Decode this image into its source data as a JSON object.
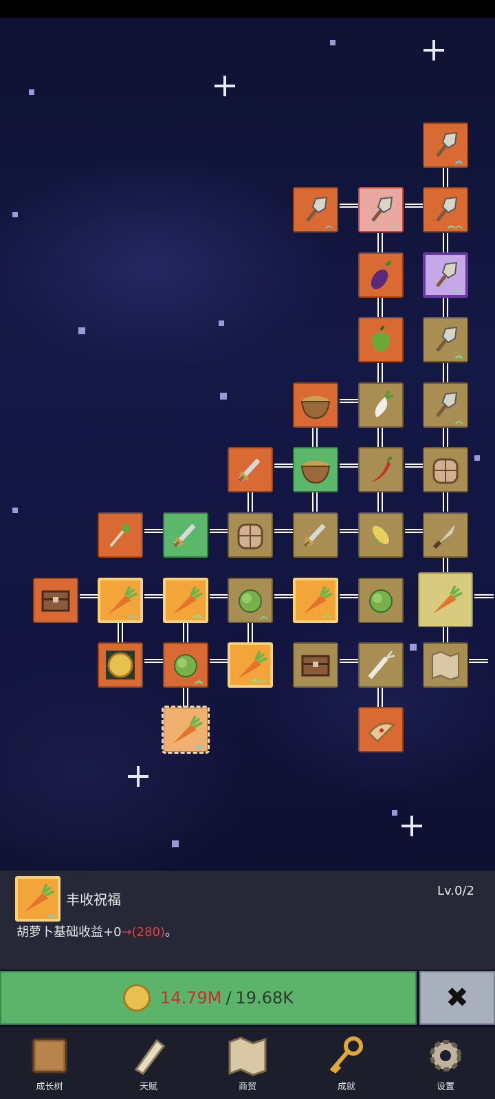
{
  "info": {
    "title": "丰收祝福",
    "level": "Lv.0/2",
    "desc_prefix": "胡萝卜基础收益+0",
    "desc_arrow": "→",
    "desc_new": "(280)",
    "desc_suffix": "。"
  },
  "cost": {
    "current": "14.79M",
    "separator": "/",
    "total": "19.68K"
  },
  "close_symbol": "✖",
  "nav": [
    {
      "label": "成长树"
    },
    {
      "label": "天赋"
    },
    {
      "label": "商贸"
    },
    {
      "label": "成就"
    },
    {
      "label": "设置"
    }
  ],
  "tiles": [
    {
      "name": "shovel",
      "color": "orange",
      "up": "blue2"
    },
    {
      "name": "shovel",
      "color": "orange",
      "up": "blue1"
    },
    {
      "name": "shovel",
      "color": "pink",
      "up": "green1"
    },
    {
      "name": "shovel",
      "color": "orange",
      "up": "green3"
    },
    {
      "name": "eggplant",
      "color": "orange"
    },
    {
      "name": "shovel",
      "color": "purple",
      "up": "green1"
    },
    {
      "name": "pepper",
      "color": "orange"
    },
    {
      "name": "shovel",
      "color": "olive",
      "up": "green2"
    },
    {
      "name": "bowl",
      "color": "orange"
    },
    {
      "name": "radish",
      "color": "olive"
    },
    {
      "name": "shovel",
      "color": "olive",
      "up": "green1"
    },
    {
      "name": "sword",
      "color": "orange"
    },
    {
      "name": "bowl",
      "color": "green"
    },
    {
      "name": "chili",
      "color": "olive"
    },
    {
      "name": "backpack",
      "color": "olive"
    },
    {
      "name": "staff",
      "color": "orange"
    },
    {
      "name": "sword",
      "color": "green"
    },
    {
      "name": "backpack",
      "color": "olive"
    },
    {
      "name": "sword",
      "color": "olive"
    },
    {
      "name": "corn",
      "color": "olive"
    },
    {
      "name": "knife",
      "color": "olive"
    },
    {
      "name": "chest",
      "color": "orange"
    },
    {
      "name": "carrot",
      "color": "gold",
      "up": "blue1"
    },
    {
      "name": "carrot",
      "color": "gold",
      "up": "green2"
    },
    {
      "name": "cabbage",
      "color": "olive",
      "up": "green1"
    },
    {
      "name": "carrot",
      "color": "gold",
      "up": "green1"
    },
    {
      "name": "cabbage",
      "color": "olive"
    },
    {
      "name": "carrot",
      "color": "big"
    },
    {
      "name": "coin",
      "color": "orange"
    },
    {
      "name": "cabbage",
      "color": "orange",
      "up": "green2"
    },
    {
      "name": "carrot",
      "color": "gold",
      "up": "green3"
    },
    {
      "name": "chest",
      "color": "olive"
    },
    {
      "name": "leek",
      "color": "olive"
    },
    {
      "name": "map",
      "color": "olive"
    },
    {
      "name": "carrot",
      "color": "dotted",
      "up": "blue2"
    },
    {
      "name": "pizza",
      "color": "orange"
    }
  ]
}
